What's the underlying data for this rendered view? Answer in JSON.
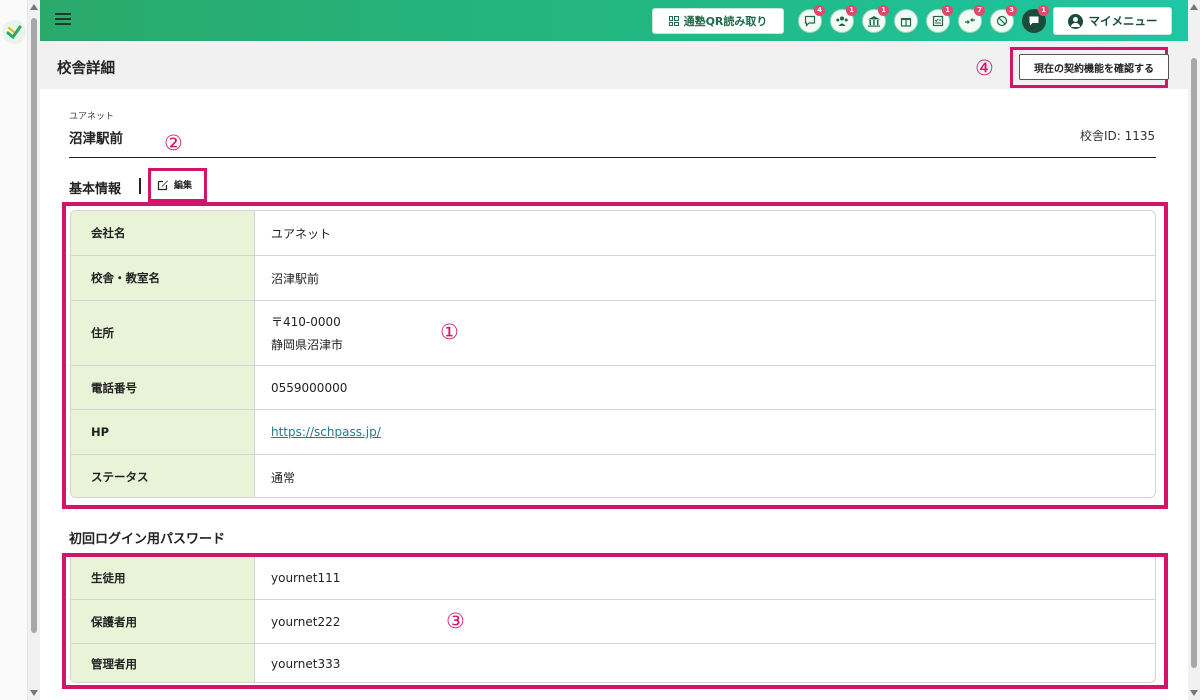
{
  "header": {
    "qr_button_label": "通塾QR読み取り",
    "my_menu_label": "マイメニュー",
    "notifications": [
      {
        "icon": "chat-bubble-icon",
        "badge": "4"
      },
      {
        "icon": "people-icon",
        "badge": "1"
      },
      {
        "icon": "school-building-icon",
        "badge": "1"
      },
      {
        "icon": "gift-icon",
        "badge": ""
      },
      {
        "icon": "checklist-icon",
        "badge": "1"
      },
      {
        "icon": "swap-arrows-icon",
        "badge": "7"
      },
      {
        "icon": "blocked-badge-icon",
        "badge": "3"
      },
      {
        "icon": "message-icon",
        "badge": "1"
      }
    ]
  },
  "page": {
    "title": "校舎詳細",
    "contract_button": "現在の契約機能を確認する",
    "fragment_text": "…"
  },
  "school": {
    "company": "ユアネット",
    "name": "沼津駅前",
    "id_label": "校舎ID: 1135"
  },
  "basic_info": {
    "title": "基本情報",
    "edit_label": "編集",
    "rows": [
      {
        "label": "会社名",
        "values": [
          "ユアネット"
        ]
      },
      {
        "label": "校舎・教室名",
        "values": [
          "沼津駅前"
        ]
      },
      {
        "label": "住所",
        "values": [
          "〒410-0000",
          "静岡県沼津市"
        ]
      },
      {
        "label": "電話番号",
        "values": [
          "0559000000"
        ]
      },
      {
        "label": "HP",
        "values": [
          "https://schpass.jp/"
        ],
        "link": true
      },
      {
        "label": "ステータス",
        "values": [
          "通常"
        ]
      }
    ]
  },
  "password": {
    "title": "初回ログイン用パスワード",
    "rows": [
      {
        "label": "生徒用",
        "value": "yournet111"
      },
      {
        "label": "保護者用",
        "value": "yournet222"
      },
      {
        "label": "管理者用",
        "value": "yournet333"
      }
    ]
  },
  "annotations": {
    "m1": "①",
    "m2": "②",
    "m3": "③",
    "m4": "④"
  },
  "colors": {
    "accent": "#d1166a",
    "header_gradient_start": "#2aa96b",
    "header_gradient_end": "#1fc6a3",
    "table_header_bg": "#e8f3d8",
    "link": "#1f7a8c"
  }
}
